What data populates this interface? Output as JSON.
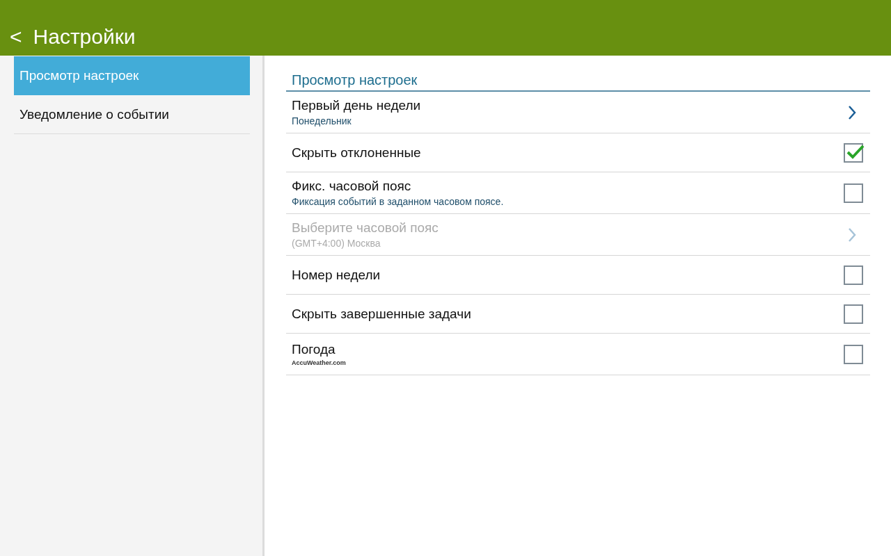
{
  "header": {
    "back": "<",
    "title": "Настройки"
  },
  "sidebar": {
    "items": [
      {
        "label": "Просмотр настроек",
        "selected": true
      },
      {
        "label": "Уведомление о событии",
        "selected": false
      }
    ]
  },
  "section": {
    "title": "Просмотр настроек",
    "rows": [
      {
        "kind": "link",
        "title": "Первый день недели",
        "subtitle": "Понедельник",
        "disabled": false
      },
      {
        "kind": "check",
        "title": "Скрыть отклоненные",
        "checked": true,
        "disabled": false
      },
      {
        "kind": "check",
        "title": "Фикс. часовой пояс",
        "subtitle": "Фиксация событий в заданном часовом поясе.",
        "checked": false,
        "disabled": false
      },
      {
        "kind": "link",
        "title": "Выберите часовой пояс",
        "subtitle": "(GMT+4:00) Москва",
        "disabled": true
      },
      {
        "kind": "check",
        "title": "Номер недели",
        "checked": false,
        "disabled": false
      },
      {
        "kind": "check",
        "title": "Скрыть завершенные задачи",
        "checked": false,
        "disabled": false
      },
      {
        "kind": "check",
        "title": "Погода",
        "logo": "AccuWeather.com",
        "checked": false,
        "disabled": false
      }
    ]
  }
}
